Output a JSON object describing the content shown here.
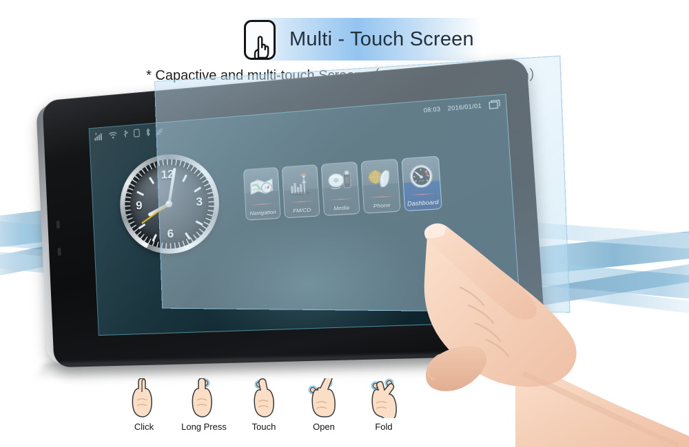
{
  "header": {
    "icon": "touch-hand-icon",
    "title": "Multi - Touch Screen",
    "subtitle": "* Capactive and multi-touch Screen  （Origonal Hanstar screen）",
    "badge_gradient": "#93c4ef"
  },
  "device": {
    "screen": {
      "statusbar": {
        "left_icons": [
          {
            "name": "signal-bars-icon",
            "label": "signal"
          },
          {
            "name": "wifi-icon",
            "label": "wifi"
          },
          {
            "name": "usb-icon",
            "label": "usb"
          },
          {
            "name": "sim-card-icon",
            "label": "sim"
          },
          {
            "name": "bluetooth-icon",
            "label": "bluetooth"
          },
          {
            "name": "gps-icon",
            "label": "gps"
          }
        ],
        "time": "08:03",
        "date": "2016/01/01",
        "window_icon": "window-icon"
      },
      "clock": {
        "numerals": [
          "12",
          "3",
          "6",
          "9"
        ]
      },
      "tiles": [
        {
          "label": "Navigation",
          "icon": "map-icon",
          "selected": false
        },
        {
          "label": "FM/CD",
          "icon": "radio-tower-icon",
          "selected": false
        },
        {
          "label": "Media",
          "icon": "disc-usb-icon",
          "selected": false
        },
        {
          "label": "Phone",
          "icon": "globe-handset-icon",
          "selected": false
        },
        {
          "label": "Dashboard",
          "icon": "speedometer-icon",
          "selected": true
        }
      ]
    }
  },
  "gestures": [
    {
      "label": "Click",
      "icon": "hand-click-icon",
      "dots": 0
    },
    {
      "label": "Long Press",
      "icon": "hand-long-press-icon",
      "dots": 1
    },
    {
      "label": "Touch",
      "icon": "hand-touch-icon",
      "dots": 1
    },
    {
      "label": "Open",
      "icon": "hand-open-icon",
      "dots": 2
    },
    {
      "label": "Fold",
      "icon": "hand-fold-icon",
      "dots": 2
    }
  ],
  "colors": {
    "accent_blue": "#93c4ef",
    "screen_dark": "#14303a",
    "tile_selected": "#164693"
  }
}
